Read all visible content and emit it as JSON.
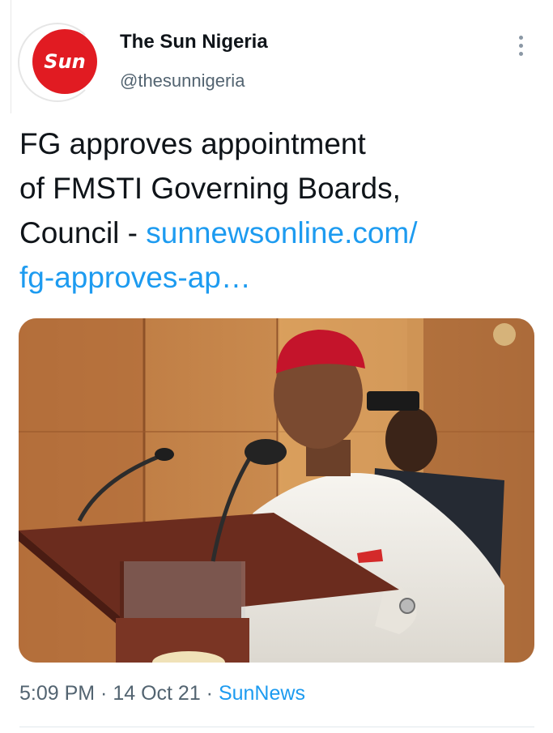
{
  "author": {
    "display_name": "The Sun Nigeria",
    "handle": "@thesunnigeria",
    "avatar_text": "Sun",
    "avatar_color": "#e11b22"
  },
  "tweet": {
    "text_lines": [
      "FG approves appointment",
      "of FMSTI Governing Boards,",
      "Council - "
    ],
    "link_part1": "sunnewsonline.com/",
    "link_part2": "fg-approves-ap…",
    "link_color": "#1d9bf0"
  },
  "media": {
    "icon": "photo-image"
  },
  "meta": {
    "time": "5:09 PM",
    "sep1": " · ",
    "date": "14 Oct 21",
    "sep2": " · ",
    "source": "SunNews"
  },
  "icons": {
    "more": "more-vertical-icon"
  }
}
